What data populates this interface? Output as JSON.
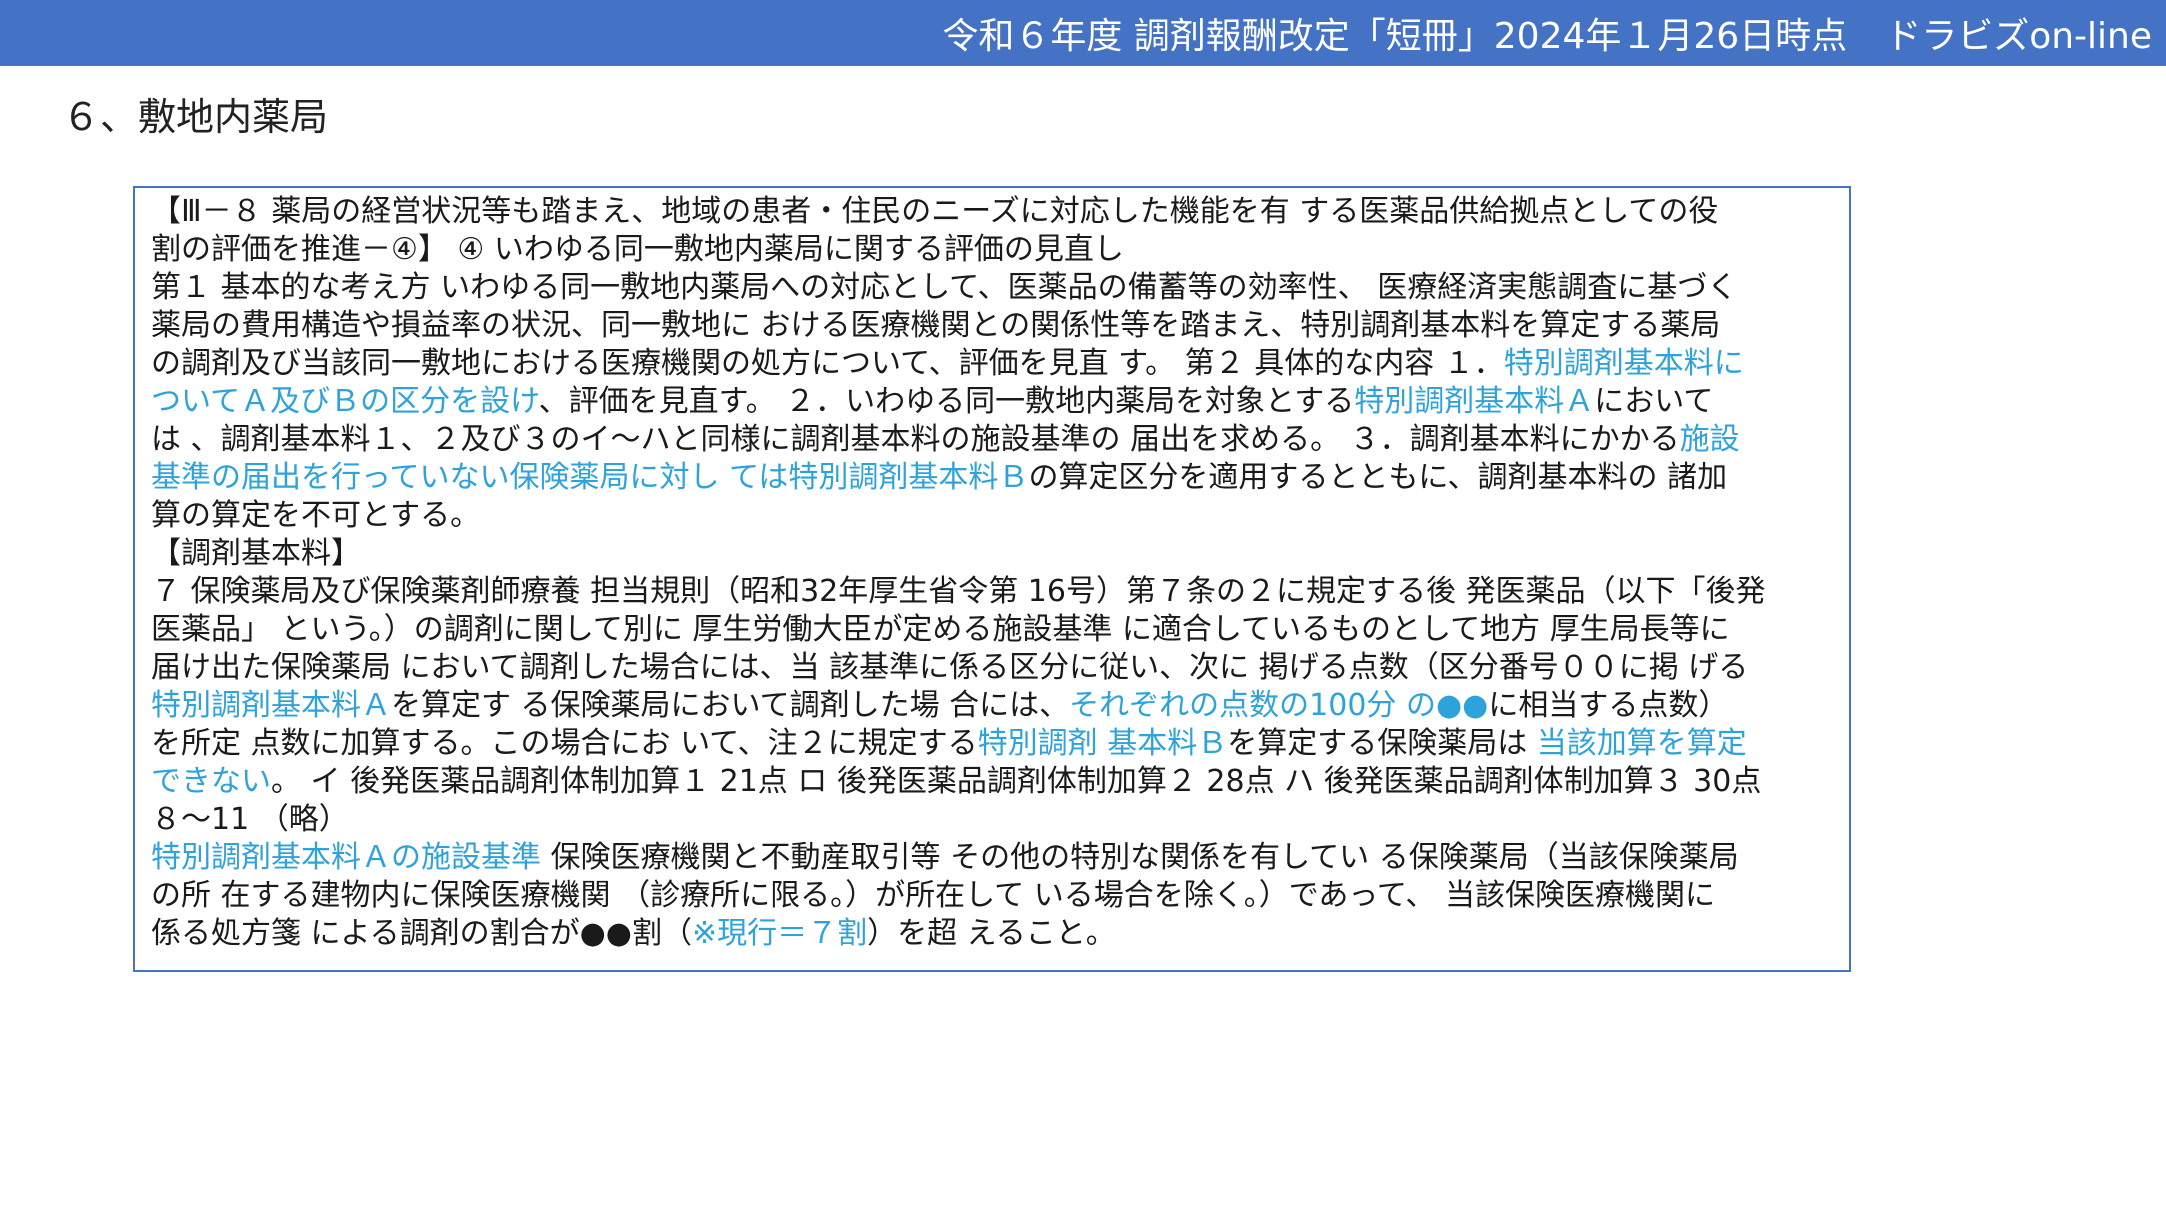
{
  "header": {
    "text": "令和６年度 調剤報酬改定「短冊」2024年１月26日時点",
    "brand": "ドラビズon-line"
  },
  "page_title": "６、敷地内薬局",
  "colors": {
    "header_bg": "#4472C4",
    "highlight": "#2EA3DB",
    "box_border": "#4472C4"
  },
  "box": {
    "lines": [
      [
        {
          "t": "【Ⅲ－８ 薬局の経営状況等も踏まえ、地域の患者・住民のニーズに対応した機能を有 する医薬品供給拠点としての役",
          "hl": false
        }
      ],
      [
        {
          "t": "割の評価を推進－④】 ④ いわゆる同一敷地内薬局に関する評価の見直し",
          "hl": false
        }
      ],
      [
        {
          "t": "第１ 基本的な考え方 いわゆる同一敷地内薬局への対応として、医薬品の備蓄等の効率性、 医療経済実態調査に基づく",
          "hl": false
        }
      ],
      [
        {
          "t": "薬局の費用構造や損益率の状況、同一敷地に おける医療機関との関係性等を踏まえ、特別調剤基本料を算定する薬局",
          "hl": false
        }
      ],
      [
        {
          "t": "の調剤及び当該同一敷地における医療機関の処方について、評価を見直 す。 第２ 具体的な内容 １．",
          "hl": false
        },
        {
          "t": "特別調剤基本料に",
          "hl": true
        }
      ],
      [
        {
          "t": "ついてＡ及びＢの区分を設け",
          "hl": true
        },
        {
          "t": "、評価を見直す。 ２．いわゆる同一敷地内薬局を対象とする",
          "hl": false
        },
        {
          "t": "特別調剤基本料Ａ",
          "hl": true
        },
        {
          "t": "において",
          "hl": false
        }
      ],
      [
        {
          "t": "は 、調剤基本料１、２及び３のイ～ハと同様に調剤基本料の施設基準の 届出を求める。 ３．調剤基本料にかかる",
          "hl": false
        },
        {
          "t": "施設",
          "hl": true
        }
      ],
      [
        {
          "t": "基準の届出を行っていない保険薬局に対し ては特別調剤基本料Ｂ",
          "hl": true
        },
        {
          "t": "の算定区分を適用するとともに、調剤基本料の 諸加",
          "hl": false
        }
      ],
      [
        {
          "t": "算の算定を不可とする。",
          "hl": false
        }
      ],
      [
        {
          "t": "【調剤基本料】",
          "hl": false
        }
      ],
      [
        {
          "t": "７ 保険薬局及び保険薬剤師療養 担当規則（昭和32年厚生省令第 16号）第７条の２に規定する後 発医薬品（以下「後発",
          "hl": false
        }
      ],
      [
        {
          "t": "医薬品」 という。）の調剤に関して別に 厚生労働大臣が定める施設基準 に適合しているものとして地方 厚生局長等に",
          "hl": false
        }
      ],
      [
        {
          "t": "届け出た保険薬局 において調剤した場合には、当 該基準に係る区分に従い、次に 掲げる点数（区分番号００に掲 げる",
          "hl": false
        }
      ],
      [
        {
          "t": "特別調剤基本料Ａ",
          "hl": true
        },
        {
          "t": "を算定す る保険薬局において調剤した場 合には、",
          "hl": false
        },
        {
          "t": "それぞれの点数の100分 の●●",
          "hl": true
        },
        {
          "t": "に相当する点数）",
          "hl": false
        }
      ],
      [
        {
          "t": "を所定 点数に加算する。この場合にお いて、注２に規定する",
          "hl": false
        },
        {
          "t": "特別調剤 基本料Ｂ",
          "hl": true
        },
        {
          "t": "を算定する保険薬局は ",
          "hl": false
        },
        {
          "t": "当該加算を算定",
          "hl": true
        }
      ],
      [
        {
          "t": "できない",
          "hl": true
        },
        {
          "t": "。 イ 後発医薬品調剤体制加算１ 21点 ロ 後発医薬品調剤体制加算２ 28点 ハ 後発医薬品調剤体制加算３ 30点",
          "hl": false
        }
      ],
      [
        {
          "t": "８～11 （略）",
          "hl": false
        }
      ],
      [
        {
          "t": "特別調剤基本料Ａの施設基準",
          "hl": true
        },
        {
          "t": " 保険医療機関と不動産取引等 その他の特別な関係を有してい る保険薬局（当該保険薬局",
          "hl": false
        }
      ],
      [
        {
          "t": "の所 在する建物内に保険医療機関 （診療所に限る。）が所在して いる場合を除く。）であって、 当該保険医療機関に",
          "hl": false
        }
      ],
      [
        {
          "t": "係る処方箋 による調剤の割合が●●割（",
          "hl": false
        },
        {
          "t": "※現行＝７割",
          "hl": true
        },
        {
          "t": "）を超 えること。",
          "hl": false
        }
      ]
    ]
  }
}
